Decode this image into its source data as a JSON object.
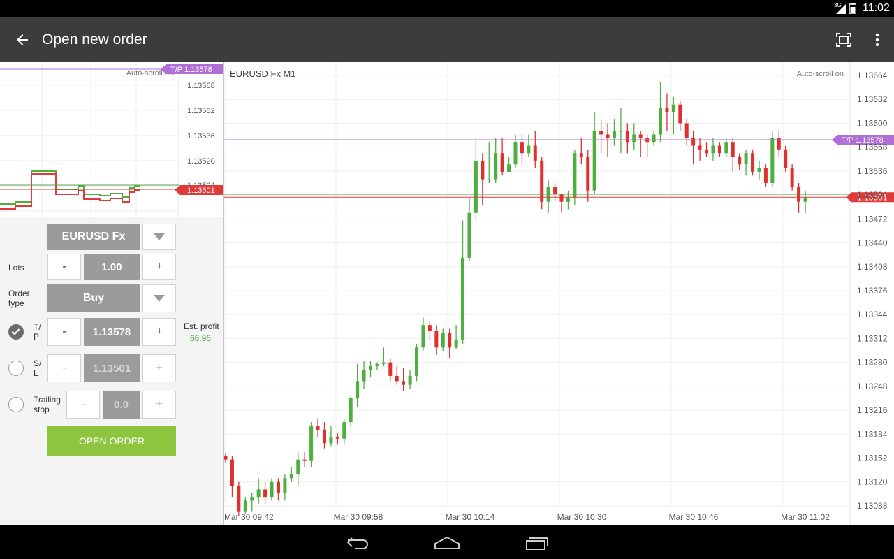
{
  "status_bar": {
    "network": "3G",
    "time": "11:02"
  },
  "app_bar": {
    "title": "Open new order",
    "back_icon": "arrow-back-icon",
    "fullscreen_icon": "fullscreen-icon",
    "menu_icon": "overflow-menu-icon"
  },
  "mini_chart": {
    "autoscroll": "Auto-scroll on",
    "ticks": [
      "1.13568",
      "1.13552",
      "1.13536",
      "1.13520",
      "1.13504"
    ],
    "tp_tag": "T/P 1.13578",
    "price_tag": "1.13501"
  },
  "order": {
    "symbol": "EURUSD Fx",
    "lots_label": "Lots",
    "lots_minus": "-",
    "lots_value": "1.00",
    "lots_plus": "+",
    "type_label": "Order\ntype",
    "type_value": "Buy",
    "tp_label": "T/\nP",
    "tp_minus": "-",
    "tp_value": "1.13578",
    "tp_plus": "+",
    "tp_checked": true,
    "est_label": "Est. profit",
    "est_value": "66.96",
    "sl_label": "S/\nL",
    "sl_minus": "-",
    "sl_value": "1.13501",
    "sl_plus": "+",
    "trail_label": "Trailing\nstop",
    "trail_minus": "-",
    "trail_value": "0.0",
    "trail_plus": "+",
    "open_button": "OPEN ORDER"
  },
  "chart_data": {
    "type": "candlestick",
    "title": "EURUSD Fx M1",
    "autoscroll": "Auto-scroll on",
    "ylim": [
      1.1307,
      1.1368
    ],
    "y_ticks": [
      "1.13664",
      "1.13632",
      "1.13600",
      "1.13568",
      "1.13536",
      "1.13504",
      "1.13472",
      "1.13440",
      "1.13408",
      "1.13376",
      "1.13344",
      "1.13312",
      "1.13280",
      "1.13248",
      "1.13216",
      "1.13184",
      "1.13152",
      "1.13120",
      "1.13088"
    ],
    "x_ticks": [
      "Mar 30 09:42",
      "Mar 30 09:58",
      "Mar 30 10:14",
      "Mar 30 10:30",
      "Mar 30 10:46",
      "Mar 30 11:02"
    ],
    "tp_line": {
      "label": "T/P 1.13578",
      "price": 1.13578,
      "color": "#b06fd6"
    },
    "bid_line": {
      "label": "1.13501",
      "price": 1.13501,
      "color": "#e03a3a"
    },
    "ask_line": {
      "price": 1.13505,
      "color": "#55aa44"
    },
    "up_color": "#4caf3e",
    "down_color": "#e0302e",
    "candles": [
      [
        1.13155,
        1.1315,
        1.13158,
        1.13145
      ],
      [
        1.1315,
        1.13115,
        1.13155,
        1.131
      ],
      [
        1.13115,
        1.1308,
        1.1312,
        1.13075
      ],
      [
        1.1308,
        1.13095,
        1.131,
        1.13078
      ],
      [
        1.13095,
        1.131,
        1.13105,
        1.1308
      ],
      [
        1.131,
        1.1311,
        1.13125,
        1.1309
      ],
      [
        1.1311,
        1.131,
        1.1312,
        1.1309
      ],
      [
        1.131,
        1.1312,
        1.13125,
        1.13095
      ],
      [
        1.1312,
        1.13105,
        1.13125,
        1.13095
      ],
      [
        1.13105,
        1.13125,
        1.1313,
        1.13095
      ],
      [
        1.13125,
        1.1313,
        1.1314,
        1.1312
      ],
      [
        1.1313,
        1.1315,
        1.1316,
        1.13115
      ],
      [
        1.1315,
        1.13148,
        1.1316,
        1.1314
      ],
      [
        1.13148,
        1.13195,
        1.132,
        1.1314
      ],
      [
        1.13195,
        1.1319,
        1.13205,
        1.1318
      ],
      [
        1.1319,
        1.13172,
        1.132,
        1.13165
      ],
      [
        1.13172,
        1.1318,
        1.13195,
        1.13168
      ],
      [
        1.1318,
        1.13178,
        1.13185,
        1.1317
      ],
      [
        1.13178,
        1.132,
        1.13205,
        1.1317
      ],
      [
        1.132,
        1.13232,
        1.13235,
        1.13195
      ],
      [
        1.13232,
        1.13255,
        1.13278,
        1.1322
      ],
      [
        1.13255,
        1.1327,
        1.13282,
        1.13245
      ],
      [
        1.1327,
        1.13275,
        1.13282,
        1.1326
      ],
      [
        1.13275,
        1.13278,
        1.1328,
        1.1327
      ],
      [
        1.13278,
        1.1328,
        1.133,
        1.13275
      ],
      [
        1.1328,
        1.13262,
        1.13285,
        1.13255
      ],
      [
        1.13262,
        1.13255,
        1.13275,
        1.1325
      ],
      [
        1.13255,
        1.1325,
        1.13272,
        1.13242
      ],
      [
        1.1325,
        1.13262,
        1.1327,
        1.13245
      ],
      [
        1.13262,
        1.133,
        1.13305,
        1.13255
      ],
      [
        1.133,
        1.1333,
        1.1334,
        1.13295
      ],
      [
        1.1333,
        1.13322,
        1.13335,
        1.1331
      ],
      [
        1.13322,
        1.133,
        1.1333,
        1.1329
      ],
      [
        1.133,
        1.1332,
        1.13325,
        1.13295
      ],
      [
        1.1332,
        1.133,
        1.13325,
        1.13285
      ],
      [
        1.133,
        1.1331,
        1.1333,
        1.13298
      ],
      [
        1.1331,
        1.1342,
        1.1347,
        1.13305
      ],
      [
        1.1342,
        1.1348,
        1.135,
        1.13415
      ],
      [
        1.1348,
        1.1355,
        1.1358,
        1.1347
      ],
      [
        1.1355,
        1.13525,
        1.1356,
        1.1349
      ],
      [
        1.13525,
        1.13525,
        1.13575,
        1.1352
      ],
      [
        1.13525,
        1.1356,
        1.1358,
        1.1352
      ],
      [
        1.1356,
        1.13535,
        1.1358,
        1.1353
      ],
      [
        1.13535,
        1.13545,
        1.13555,
        1.13535
      ],
      [
        1.13545,
        1.13575,
        1.13585,
        1.1354
      ],
      [
        1.13575,
        1.1356,
        1.13585,
        1.13545
      ],
      [
        1.1356,
        1.1357,
        1.13585,
        1.13555
      ],
      [
        1.1357,
        1.1355,
        1.1359,
        1.1354
      ],
      [
        1.1355,
        1.13495,
        1.13555,
        1.13485
      ],
      [
        1.13495,
        1.13515,
        1.13525,
        1.1348
      ],
      [
        1.13515,
        1.13505,
        1.1352,
        1.13495
      ],
      [
        1.13505,
        1.13495,
        1.135,
        1.1348
      ],
      [
        1.13495,
        1.135,
        1.1351,
        1.13485
      ],
      [
        1.135,
        1.1356,
        1.13565,
        1.1349
      ],
      [
        1.1356,
        1.13555,
        1.1358,
        1.13545
      ],
      [
        1.13555,
        1.1351,
        1.13565,
        1.13495
      ],
      [
        1.1351,
        1.1359,
        1.13615,
        1.13505
      ],
      [
        1.1359,
        1.13585,
        1.13605,
        1.1356
      ],
      [
        1.13585,
        1.1358,
        1.136,
        1.13555
      ],
      [
        1.1358,
        1.1359,
        1.13605,
        1.1357
      ],
      [
        1.1359,
        1.1359,
        1.1362,
        1.1356
      ],
      [
        1.1359,
        1.13575,
        1.136,
        1.1356
      ],
      [
        1.13575,
        1.13585,
        1.136,
        1.13565
      ],
      [
        1.13585,
        1.1358,
        1.1359,
        1.13555
      ],
      [
        1.1358,
        1.13575,
        1.13585,
        1.13555
      ],
      [
        1.13575,
        1.13585,
        1.1359,
        1.1357
      ],
      [
        1.13585,
        1.1362,
        1.13655,
        1.13575
      ],
      [
        1.1362,
        1.13615,
        1.1364,
        1.1359
      ],
      [
        1.13615,
        1.13625,
        1.13635,
        1.13585
      ],
      [
        1.13625,
        1.136,
        1.1363,
        1.1359
      ],
      [
        1.136,
        1.1358,
        1.13605,
        1.1357
      ],
      [
        1.1358,
        1.1357,
        1.1359,
        1.13545
      ],
      [
        1.1357,
        1.13565,
        1.1358,
        1.1355
      ],
      [
        1.13565,
        1.1356,
        1.13575,
        1.13555
      ],
      [
        1.1356,
        1.1357,
        1.1358,
        1.1355
      ],
      [
        1.1357,
        1.1356,
        1.13575,
        1.13555
      ],
      [
        1.1356,
        1.13575,
        1.1358,
        1.13555
      ],
      [
        1.13575,
        1.13555,
        1.1358,
        1.13535
      ],
      [
        1.13555,
        1.13545,
        1.1356,
        1.13538
      ],
      [
        1.13545,
        1.1356,
        1.13565,
        1.1353
      ],
      [
        1.1356,
        1.13535,
        1.13565,
        1.1353
      ],
      [
        1.13535,
        1.1354,
        1.1355,
        1.13525
      ],
      [
        1.1354,
        1.1352,
        1.13545,
        1.13515
      ],
      [
        1.1352,
        1.1358,
        1.1359,
        1.13515
      ],
      [
        1.1358,
        1.13565,
        1.1359,
        1.13555
      ],
      [
        1.13565,
        1.1354,
        1.1357,
        1.13535
      ],
      [
        1.1354,
        1.13515,
        1.13545,
        1.1351
      ],
      [
        1.13515,
        1.13495,
        1.1352,
        1.1348
      ],
      [
        1.13495,
        1.135,
        1.1351,
        1.1348
      ]
    ]
  }
}
